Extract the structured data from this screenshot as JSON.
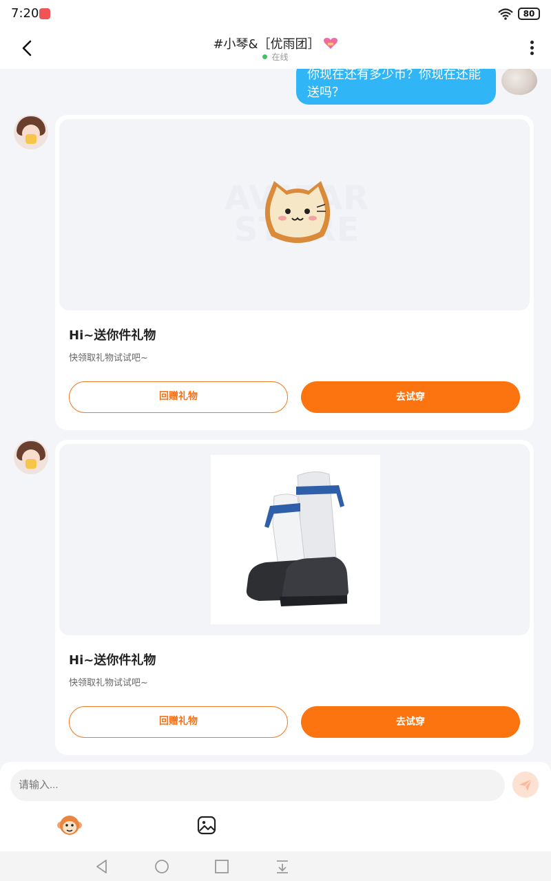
{
  "status_bar": {
    "time": "7:20",
    "battery": "80"
  },
  "header": {
    "title": "#小琴&［优雨团］",
    "status": "在线"
  },
  "messages": {
    "outgoing_text": "你现在还有多少币？你现在还能送吗？"
  },
  "gift_cards": [
    {
      "title": "Hi~送你件礼物",
      "subtitle": "快领取礼物试试吧~",
      "return_gift_label": "回赠礼物",
      "try_on_label": "去试穿",
      "watermark": "AVATAR STORE",
      "media_icon": "cat-toast-icon"
    },
    {
      "title": "Hi~送你件礼物",
      "subtitle": "快领取礼物试试吧~",
      "return_gift_label": "回赠礼物",
      "try_on_label": "去试穿",
      "media_icon": "boots-icon"
    }
  ],
  "input": {
    "placeholder": "请输入..."
  },
  "colors": {
    "accent": "#fb7410",
    "bubble": "#30b6f7",
    "online": "#3bc45f"
  }
}
